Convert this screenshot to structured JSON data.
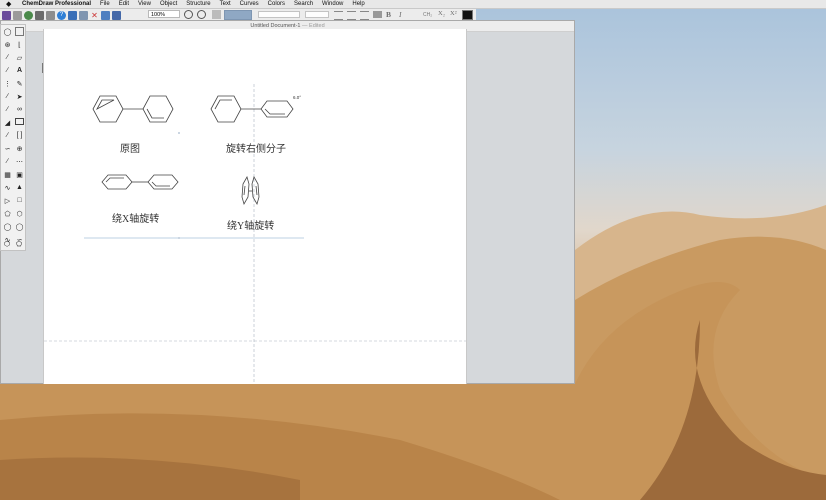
{
  "menubar": {
    "app_name": "ChemDraw Professional",
    "items": [
      "File",
      "Edit",
      "View",
      "Object",
      "Structure",
      "Text",
      "Curves",
      "Colors",
      "Search",
      "Window",
      "Help"
    ]
  },
  "toolbar": {
    "zoom_value": "100%",
    "format_buttons": [
      "B",
      "I",
      "X₂",
      "X²"
    ]
  },
  "document": {
    "title": "Untitled Document-1",
    "status": "— Edited"
  },
  "canvas": {
    "captions": {
      "original": "原图",
      "rotate_right": "旋转右侧分子",
      "rotate_x": "绕X轴旋转",
      "rotate_y": "绕Y轴旋转"
    },
    "angle_label": "6.0°"
  },
  "icons": [
    "apple-icon",
    "new-doc-icon",
    "open-icon",
    "save-icon",
    "print-icon",
    "help-icon",
    "undo-icon",
    "redo-icon",
    "cut-icon",
    "copy-icon",
    "paste-icon",
    "zoom-in-icon",
    "zoom-out-icon",
    "lasso-icon",
    "marquee-icon",
    "bond-icon",
    "text-tool-icon",
    "ring-tool-icon"
  ],
  "colors": {
    "accent_swatch": "#8fa8c4",
    "current_color": "#111111"
  }
}
